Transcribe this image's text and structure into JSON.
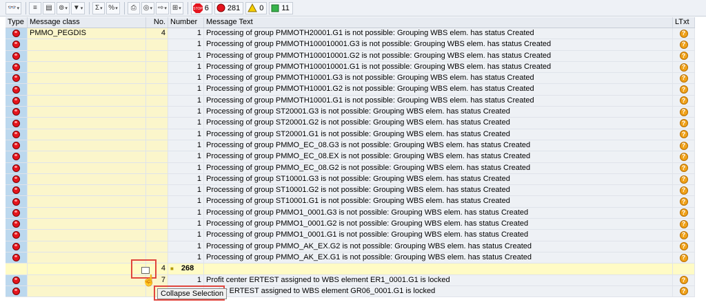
{
  "toolbar": {
    "buttons": [
      "glasses-icon",
      "align-left-icon",
      "filter-table-icon",
      "binoculars-icon",
      "filter-icon",
      "sum-icon",
      "subtotal-icon",
      "print-icon",
      "view-icon",
      "export-icon",
      "layout-icon"
    ],
    "counters": [
      {
        "icon": "stop-icon",
        "value": "6",
        "color": "#e4141e"
      },
      {
        "icon": "error-icon",
        "value": "281",
        "color": "#e4141e"
      },
      {
        "icon": "warning-icon",
        "value": "0",
        "color": "#f6cf00"
      },
      {
        "icon": "success-icon",
        "value": "11",
        "color": "#37b34a"
      }
    ]
  },
  "grid": {
    "headers": {
      "type": "Type",
      "class": "Message class",
      "no": "No.",
      "number": "Number",
      "text": "Message Text",
      "ltxt": "LTxt"
    },
    "rows": [
      {
        "class": "PMMO_PEGDIS",
        "no": "4",
        "number": "1",
        "text": "Processing of group PMMOTH20001.G1 is not possible: Grouping WBS elem. has status Created"
      },
      {
        "class": "",
        "no": "",
        "number": "1",
        "text": "Processing of group PMMOTH100010001.G3 is not possible: Grouping WBS elem. has status Created"
      },
      {
        "class": "",
        "no": "",
        "number": "1",
        "text": "Processing of group PMMOTH100010001.G2 is not possible: Grouping WBS elem. has status Created"
      },
      {
        "class": "",
        "no": "",
        "number": "1",
        "text": "Processing of group PMMOTH100010001.G1 is not possible: Grouping WBS elem. has status Created"
      },
      {
        "class": "",
        "no": "",
        "number": "1",
        "text": "Processing of group PMMOTH10001.G3 is not possible: Grouping WBS elem. has status Created"
      },
      {
        "class": "",
        "no": "",
        "number": "1",
        "text": "Processing of group PMMOTH10001.G2 is not possible: Grouping WBS elem. has status Created"
      },
      {
        "class": "",
        "no": "",
        "number": "1",
        "text": "Processing of group PMMOTH10001.G1 is not possible: Grouping WBS elem. has status Created"
      },
      {
        "class": "",
        "no": "",
        "number": "1",
        "text": "Processing of group ST20001.G3 is not possible: Grouping WBS elem. has status Created"
      },
      {
        "class": "",
        "no": "",
        "number": "1",
        "text": "Processing of group ST20001.G2 is not possible: Grouping WBS elem. has status Created"
      },
      {
        "class": "",
        "no": "",
        "number": "1",
        "text": "Processing of group ST20001.G1 is not possible: Grouping WBS elem. has status Created"
      },
      {
        "class": "",
        "no": "",
        "number": "1",
        "text": "Processing of group PMMO_EC_08.G3 is not possible: Grouping WBS elem. has status Created"
      },
      {
        "class": "",
        "no": "",
        "number": "1",
        "text": "Processing of group PMMO_EC_08.EX is not possible: Grouping WBS elem. has status Created"
      },
      {
        "class": "",
        "no": "",
        "number": "1",
        "text": "Processing of group PMMO_EC_08.G2 is not possible: Grouping WBS elem. has status Created"
      },
      {
        "class": "",
        "no": "",
        "number": "1",
        "text": "Processing of group ST10001.G3 is not possible: Grouping WBS elem. has status Created"
      },
      {
        "class": "",
        "no": "",
        "number": "1",
        "text": "Processing of group ST10001.G2 is not possible: Grouping WBS elem. has status Created"
      },
      {
        "class": "",
        "no": "",
        "number": "1",
        "text": "Processing of group ST10001.G1 is not possible: Grouping WBS elem. has status Created"
      },
      {
        "class": "",
        "no": "",
        "number": "1",
        "text": "Processing of group PMMO1_0001.G3 is not possible: Grouping WBS elem. has status Created"
      },
      {
        "class": "",
        "no": "",
        "number": "1",
        "text": "Processing of group PMMO1_0001.G2 is not possible: Grouping WBS elem. has status Created"
      },
      {
        "class": "",
        "no": "",
        "number": "1",
        "text": "Processing of group PMMO1_0001.G1 is not possible: Grouping WBS elem. has status Created"
      },
      {
        "class": "",
        "no": "",
        "number": "1",
        "text": "Processing of group PMMO_AK_EX.G2 is not possible: Grouping WBS elem. has status Created"
      },
      {
        "class": "",
        "no": "",
        "number": "1",
        "text": "Processing of group PMMO_AK_EX.G1 is not possible: Grouping WBS elem. has status Created"
      }
    ],
    "subtotal": {
      "no": "4",
      "mark": "■",
      "total": "268"
    },
    "after_rows": [
      {
        "class": "",
        "no": "7",
        "number": "1",
        "text": "Profit center ERTEST assigned to WBS element ER1_0001.G1 is locked"
      },
      {
        "class": "",
        "no": "",
        "number": "",
        "text": "center ERTEST assigned to WBS element GR06_0001.G1 is locked"
      }
    ]
  },
  "tooltip": {
    "text": "Collapse Selection"
  }
}
